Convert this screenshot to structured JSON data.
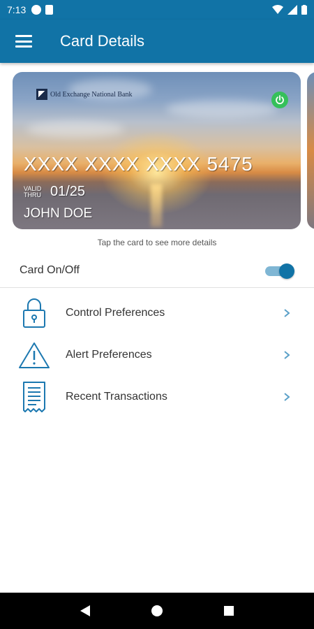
{
  "status_bar": {
    "time": "7:13",
    "icons": [
      "app-notification-icon",
      "sd-card-icon",
      "wifi-icon",
      "signal-icon",
      "battery-icon"
    ]
  },
  "app_bar": {
    "title": "Card Details",
    "menu_icon": "hamburger-menu-icon"
  },
  "card": {
    "bank_name": "Old Exchange National Bank",
    "number": "XXXX XXXX XXXX 5475",
    "valid_label_1": "VALID",
    "valid_label_2": "THRU",
    "expiry": "01/25",
    "holder": "JOHN DOE",
    "power_icon": "power-icon",
    "power_color": "#35c05a"
  },
  "hint": "Tap the card to see more details",
  "card_toggle": {
    "label": "Card On/Off",
    "state": "on"
  },
  "menu": [
    {
      "label": "Control Preferences",
      "icon": "lock-icon"
    },
    {
      "label": "Alert Preferences",
      "icon": "warning-icon"
    },
    {
      "label": "Recent Transactions",
      "icon": "receipt-icon"
    }
  ],
  "colors": {
    "primary": "#1173a6",
    "icon_blue": "#1c78b0",
    "toggle_track": "#7fb6d4"
  },
  "nav_bar": [
    "back-icon",
    "home-icon",
    "recents-icon"
  ]
}
